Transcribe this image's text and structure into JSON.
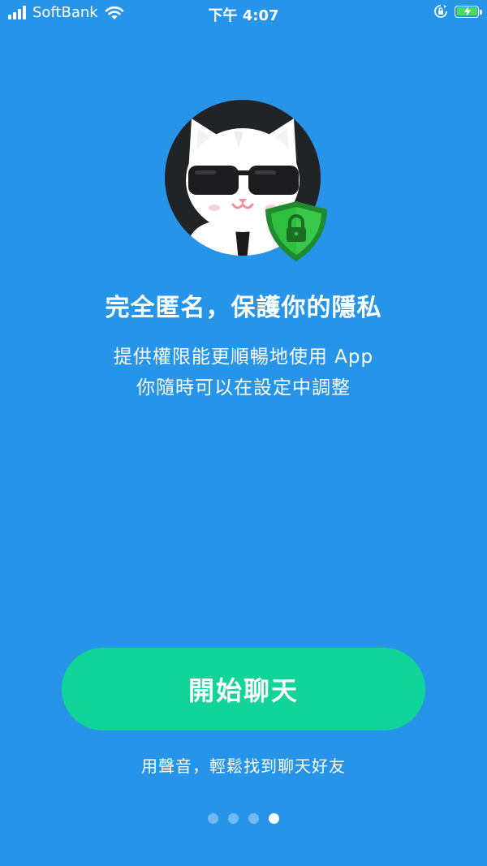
{
  "status_bar": {
    "carrier": "SoftBank",
    "time": "下午 4:07",
    "icons": [
      "signal-icon",
      "wifi-icon",
      "rotation-lock-icon",
      "battery-charging-icon"
    ]
  },
  "onboarding": {
    "title": "完全匿名，保護你的隱私",
    "subtitle_line1": "提供權限能更順暢地使用 App",
    "subtitle_line2": "你隨時可以在設定中調整",
    "start_button": "開始聊天",
    "tagline": "用聲音，輕鬆找到聊天好友",
    "page_count": 4,
    "active_page": 4
  },
  "colors": {
    "background": "#2694E8",
    "button": "#10D498",
    "shield": "#2FBE3E"
  }
}
